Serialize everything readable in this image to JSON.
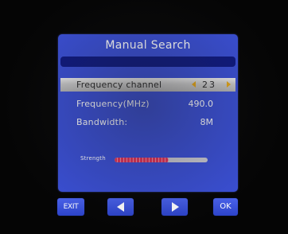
{
  "menu": {
    "title": "Manual Search",
    "rows": [
      {
        "label": "Frequency channel",
        "value": "23"
      },
      {
        "label": "Frequency(MHz)",
        "value": "490.0"
      },
      {
        "label": "Bandwidth:",
        "value": "8M"
      }
    ],
    "strength": {
      "label": "Strength",
      "level": 0.58
    }
  },
  "buttons": {
    "exit": "EXIT",
    "left_icon": "left-arrow-icon",
    "right_icon": "right-arrow-icon",
    "ok": "OK"
  },
  "colors": {
    "panel": "#3a4fd4",
    "title_band": "#0f1a80",
    "selected_row": "#c8c8c8",
    "channel_arrows": "#e3a51a",
    "strength_fill": "#e0335a"
  }
}
